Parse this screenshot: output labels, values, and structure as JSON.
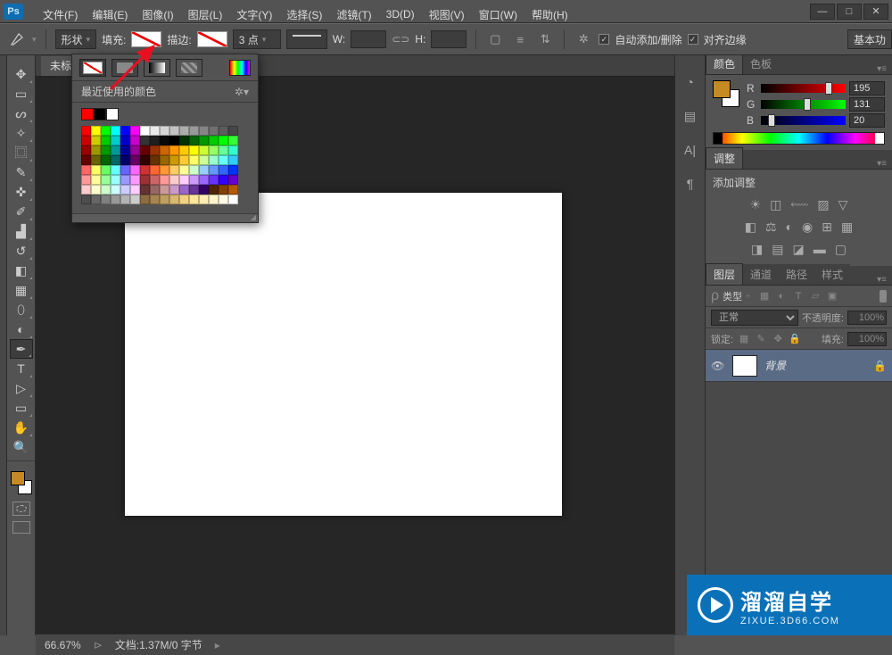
{
  "title_bar": {
    "logo": "Ps"
  },
  "window_controls": {
    "min": "—",
    "max": "□",
    "close": "✕"
  },
  "menu": [
    "文件(F)",
    "编辑(E)",
    "图像(I)",
    "图层(L)",
    "文字(Y)",
    "选择(S)",
    "滤镜(T)",
    "3D(D)",
    "视图(V)",
    "窗口(W)",
    "帮助(H)"
  ],
  "options": {
    "shape_label": "形状",
    "fill_label": "填充:",
    "stroke_label": "描边:",
    "stroke_width": "3 点",
    "w_label": "W:",
    "h_label": "H:",
    "w_val": "",
    "h_val": "",
    "auto_add": "自动添加/删除",
    "align_edges": "对齐边缘",
    "basic": "基本功"
  },
  "doc_tab": "未标",
  "fill_popup": {
    "recent_label": "最近使用的颜色",
    "recent": [
      "#ff0000",
      "#000000",
      "#ffffff"
    ],
    "grid_colors": [
      "#ff0000",
      "#ffff00",
      "#00ff00",
      "#00ffff",
      "#0000ff",
      "#ff00ff",
      "#ffffff",
      "#ebebeb",
      "#d6d6d6",
      "#c2c2c2",
      "#adadad",
      "#999999",
      "#858585",
      "#707070",
      "#5c5c5c",
      "#474747",
      "#cc0000",
      "#cccc00",
      "#00cc00",
      "#00cccc",
      "#0000cc",
      "#cc00cc",
      "#333333",
      "#1f1f1f",
      "#0a0a0a",
      "#000000",
      "#003300",
      "#006600",
      "#009900",
      "#00cc00",
      "#00ff00",
      "#33ff33",
      "#990000",
      "#999900",
      "#009900",
      "#009999",
      "#000099",
      "#990099",
      "#660000",
      "#993300",
      "#cc6600",
      "#ff9900",
      "#ffcc00",
      "#ffff00",
      "#ccff33",
      "#99ff66",
      "#66ff99",
      "#33ffcc",
      "#660000",
      "#666600",
      "#006600",
      "#006666",
      "#000066",
      "#660066",
      "#330000",
      "#663300",
      "#996600",
      "#cc9900",
      "#ffcc33",
      "#ffff66",
      "#ccff99",
      "#99ffcc",
      "#66ffff",
      "#33ccff",
      "#ff6666",
      "#ffff66",
      "#66ff66",
      "#66ffff",
      "#6666ff",
      "#ff66ff",
      "#cc3333",
      "#ff6633",
      "#ff9933",
      "#ffcc66",
      "#ffff99",
      "#ccffcc",
      "#99ccff",
      "#6699ff",
      "#3366ff",
      "#0033ff",
      "#ff9999",
      "#ffff99",
      "#99ff99",
      "#99ffff",
      "#9999ff",
      "#ff99ff",
      "#993333",
      "#cc6666",
      "#ff9999",
      "#ffcccc",
      "#ffccff",
      "#cc99ff",
      "#9966ff",
      "#6633ff",
      "#3300ff",
      "#6600cc",
      "#ffcccc",
      "#ffffcc",
      "#ccffcc",
      "#ccffff",
      "#ccccff",
      "#ffccff",
      "#663333",
      "#996666",
      "#cc9999",
      "#cc99cc",
      "#9966cc",
      "#663399",
      "#330066",
      "#4d2600",
      "#804000",
      "#b35900",
      "#4d4d4d",
      "#666666",
      "#808080",
      "#999999",
      "#b3b3b3",
      "#cccccc",
      "#8c6b3f",
      "#a68550",
      "#bf9f60",
      "#d9b870",
      "#f2d280",
      "#ffe699",
      "#ffedb3",
      "#fff4cc",
      "#fffae6",
      "#ffffff"
    ]
  },
  "panels": {
    "color_tab": "颜色",
    "swatch_tab": "色板",
    "r_label": "R",
    "g_label": "G",
    "b_label": "B",
    "r_val": "195",
    "g_val": "131",
    "b_val": "20",
    "adjust_tab": "调整",
    "adjust_add": "添加调整",
    "layers_tab": "图层",
    "channels_tab": "通道",
    "paths_tab": "路径",
    "styles_tab": "样式",
    "filter_label": "类型",
    "blend_mode": "正常",
    "opacity_label": "不透明度:",
    "opacity_val": "100%",
    "lock_label": "锁定:",
    "fill_label": "填充:",
    "fill_val": "100%",
    "bg_layer": "背景"
  },
  "status": {
    "zoom": "66.67%",
    "doc_info": "文档:1.37M/0 字节"
  },
  "watermark": {
    "big": "溜溜自学",
    "small": "ZIXUE.3D66.COM"
  },
  "tools": [
    "move",
    "marquee",
    "lasso",
    "wand",
    "crop",
    "eyedrop",
    "heal",
    "brush",
    "stamp",
    "history",
    "eraser",
    "gradient",
    "blur",
    "dodge",
    "pen",
    "type",
    "path",
    "shape",
    "hand",
    "zoom"
  ]
}
